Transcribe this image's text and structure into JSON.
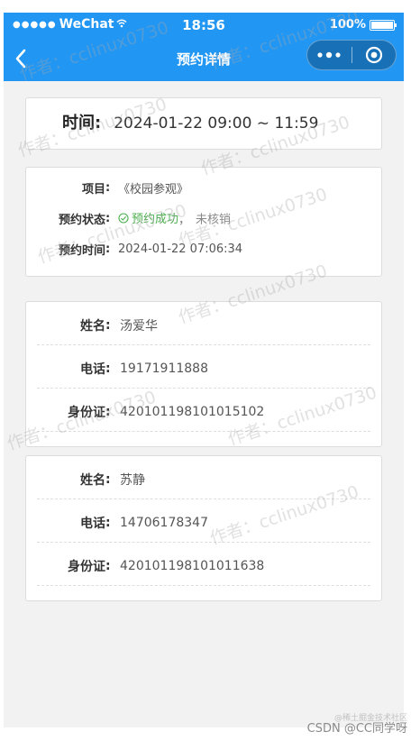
{
  "status_bar": {
    "dots": "●●●●●",
    "carrier": "WeChat",
    "time": "18:56",
    "battery": "100%"
  },
  "nav": {
    "title": "预约详情"
  },
  "time_card": {
    "label": "时间",
    "colon": ":",
    "value": "2024-01-22 09:00 ~ 11:59"
  },
  "info_card": {
    "rows": [
      {
        "label": "项目",
        "value": "《校园参观》"
      },
      {
        "label": "预约状态",
        "status": "预约成功",
        "comma": "，",
        "extra": "未核销"
      },
      {
        "label": "预约时间",
        "value": "2024-01-22 07:06:34"
      }
    ],
    "colon": ":"
  },
  "persons": [
    {
      "name_label": "姓名",
      "name": "汤爱华",
      "phone_label": "电话",
      "phone": "19171911888",
      "id_label": "身份证",
      "id": "420101198101015102"
    },
    {
      "name_label": "姓名",
      "name": "苏静",
      "phone_label": "电话",
      "phone": "14706178347",
      "id_label": "身份证",
      "id": "420101198101011638"
    }
  ],
  "watermark_text": "作者：cclinux0730",
  "footer": {
    "credit": "CSDN @CC同学呀",
    "sub": "@稀土掘金技术社区"
  },
  "colors": {
    "nav_bg": "#2196f3",
    "success": "#4caf50",
    "page_bg": "#f2f2f2"
  }
}
